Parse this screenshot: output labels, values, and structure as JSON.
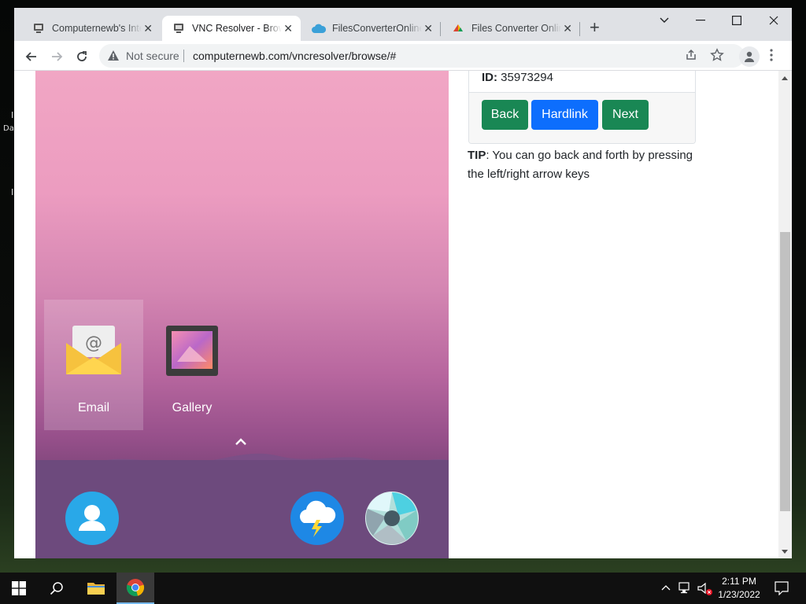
{
  "browser": {
    "tabs": [
      {
        "title": "Computernewb's Internet",
        "active": false
      },
      {
        "title": "VNC Resolver - Browse",
        "active": true
      },
      {
        "title": "FilesConverterOnline",
        "active": false
      },
      {
        "title": "Files Converter Online",
        "active": false
      }
    ],
    "close_glyph": "✕",
    "new_tab_glyph": "+",
    "security_label": "Not secure",
    "url": "computernewb.com/vncresolver/browse/#"
  },
  "vnc": {
    "apps": [
      {
        "label": "Email",
        "icon": "email-icon"
      },
      {
        "label": "Gallery",
        "icon": "gallery-icon"
      }
    ],
    "dock_icons": [
      "contacts-icon",
      "weather-icon",
      "camera-icon"
    ]
  },
  "card": {
    "id_label": "ID:",
    "id_value": "35973294",
    "buttons": {
      "back": "Back",
      "hardlink": "Hardlink",
      "next": "Next"
    }
  },
  "tip": {
    "label": "TIP",
    "text": ": You can go back and forth by pressing the left/right arrow keys"
  },
  "taskbar": {
    "time": "2:11 PM",
    "date": "1/23/2022"
  },
  "colors": {
    "success": "#198754",
    "primary": "#0d6efd"
  }
}
